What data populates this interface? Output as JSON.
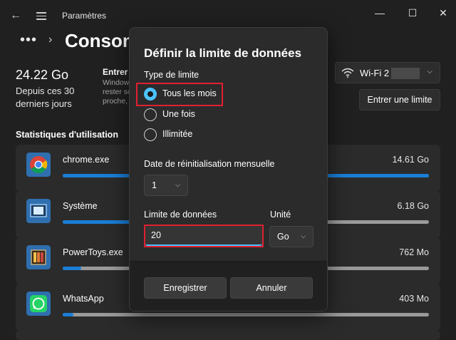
{
  "window": {
    "title": "Paramètres",
    "controls": {
      "minimize": "—",
      "maximize": "☐",
      "close": "✕"
    }
  },
  "breadcrumb": {
    "more": "•••",
    "separator": "›",
    "page_title": "Consommation des données"
  },
  "summary": {
    "amount": "24.22 Go",
    "period": "Depuis ces 30 derniers jours",
    "limit_heading": "Entrer",
    "limit_description": "Windows\nrester so\nproche,"
  },
  "network": {
    "label": "Wi-Fi 2",
    "icon": "wifi-icon"
  },
  "enter_limit_button": "Entrer une limite",
  "stats_title": "Statistiques d'utilisation",
  "apps": [
    {
      "name": "chrome.exe",
      "size": "14.61 Go",
      "fraction": 1.0,
      "icon": "chrome-icon"
    },
    {
      "name": "Système",
      "size": "6.18 Go",
      "fraction": 0.42,
      "icon": "system-icon"
    },
    {
      "name": "PowerToys.exe",
      "size": "762 Mo",
      "fraction": 0.05,
      "icon": "powertoys-icon"
    },
    {
      "name": "WhatsApp",
      "size": "403 Mo",
      "fraction": 0.03,
      "icon": "whatsapp-icon"
    }
  ],
  "dialog": {
    "title": "Définir la limite de données",
    "limit_type_label": "Type de limite",
    "options": [
      "Tous les mois",
      "Une fois",
      "Illimitée"
    ],
    "selected_option": "Tous les mois",
    "reset_date_label": "Date de réinitialisation mensuelle",
    "reset_day": "1",
    "data_limit_label": "Limite de données",
    "data_limit_value": "20",
    "unit_label": "Unité",
    "unit_value": "Go",
    "save_button": "Enregistrer",
    "cancel_button": "Annuler"
  },
  "colors": {
    "accent": "#4cc2ff",
    "bar_fill": "#1a7ed6",
    "highlight": "#e02030",
    "background": "#202020"
  }
}
